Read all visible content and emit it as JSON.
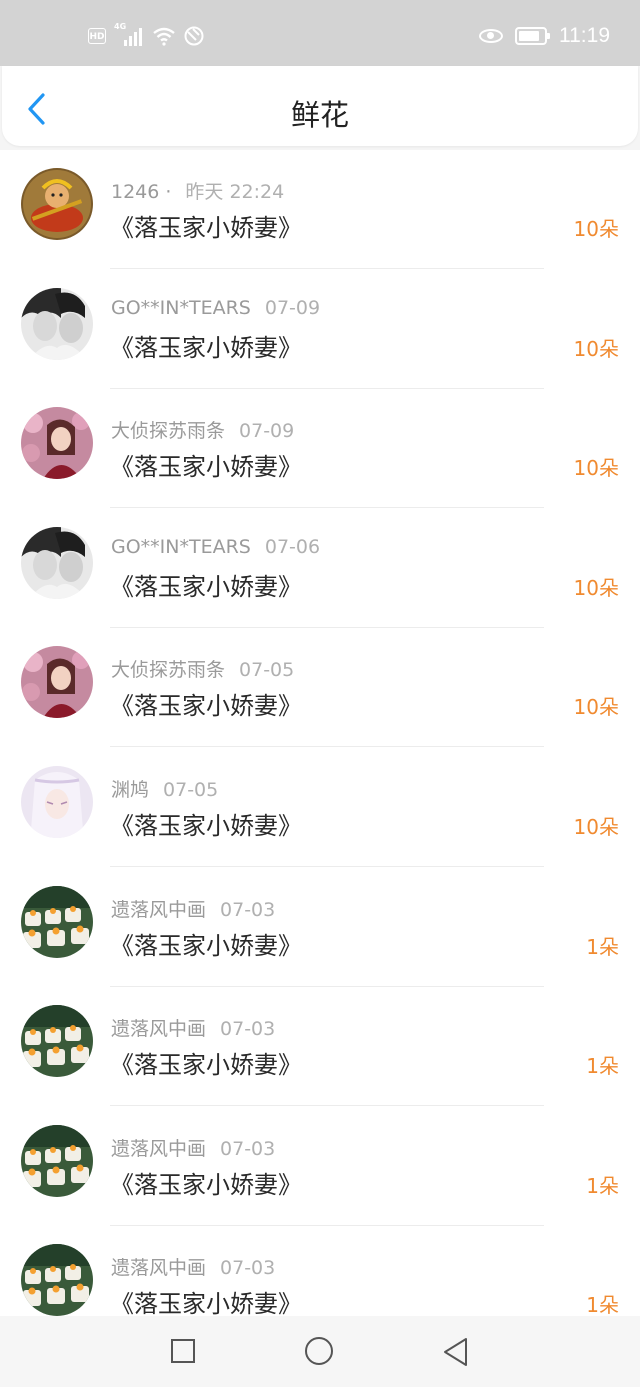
{
  "status_bar": {
    "network": "4G",
    "hd": "HD",
    "time": "11:19"
  },
  "header": {
    "title": "鲜花"
  },
  "flowers": [
    {
      "user": "1246",
      "separator": "·",
      "date": "昨天 22:24",
      "book": "《落玉家小娇妻》",
      "count": "10朵",
      "avatar": "monkey-king-avatar"
    },
    {
      "user": "GO**IN*TEARS",
      "date": "07-09",
      "book": "《落玉家小娇妻》",
      "count": "10朵",
      "avatar": "couple-bw-avatar"
    },
    {
      "user": "大侦探苏雨条",
      "date": "07-09",
      "book": "《落玉家小娇妻》",
      "count": "10朵",
      "avatar": "girl-blossom-avatar"
    },
    {
      "user": "GO**IN*TEARS",
      "date": "07-06",
      "book": "《落玉家小娇妻》",
      "count": "10朵",
      "avatar": "couple-bw-avatar"
    },
    {
      "user": "大侦探苏雨条",
      "date": "07-05",
      "book": "《落玉家小娇妻》",
      "count": "10朵",
      "avatar": "girl-blossom-avatar"
    },
    {
      "user": "渊鸠",
      "date": "07-05",
      "book": "《落玉家小娇妻》",
      "count": "10朵",
      "avatar": "white-hair-anime-avatar"
    },
    {
      "user": "遗落风中画",
      "date": "07-03",
      "book": "《落玉家小娇妻》",
      "count": "1朵",
      "avatar": "cakes-avatar"
    },
    {
      "user": "遗落风中画",
      "date": "07-03",
      "book": "《落玉家小娇妻》",
      "count": "1朵",
      "avatar": "cakes-avatar"
    },
    {
      "user": "遗落风中画",
      "date": "07-03",
      "book": "《落玉家小娇妻》",
      "count": "1朵",
      "avatar": "cakes-avatar"
    },
    {
      "user": "遗落风中画",
      "date": "07-03",
      "book": "《落玉家小娇妻》",
      "count": "1朵",
      "avatar": "cakes-avatar"
    }
  ],
  "colors": {
    "accent": "#1e90ff",
    "count": "#f08a30",
    "meta": "#9a9a9a"
  }
}
